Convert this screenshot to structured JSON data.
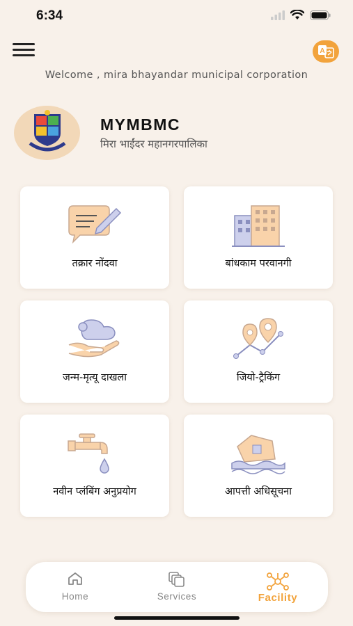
{
  "status": {
    "time": "6:34"
  },
  "header": {
    "welcome": "Welcome , mira bhayandar municipal corporation",
    "title": "MYMBMC",
    "subtitle": "मिरा भाईंदर महानगरपालिका"
  },
  "cards": [
    {
      "label": "तक्रार नोंदवा",
      "icon": "complaint-icon"
    },
    {
      "label": "बांधकाम परवानगी",
      "icon": "building-icon"
    },
    {
      "label": "जन्म-मृत्यू दाखला",
      "icon": "birth-death-icon"
    },
    {
      "label": "जियो-ट्रैकिंग",
      "icon": "geo-tracking-icon"
    },
    {
      "label": "नवीन प्लंबिंग अनुप्रयोग",
      "icon": "plumbing-tap-icon"
    },
    {
      "label": "आपत्ती अधिसूचना",
      "icon": "disaster-icon"
    }
  ],
  "nav": {
    "items": [
      {
        "label": "Home",
        "icon": "home-icon"
      },
      {
        "label": "Services",
        "icon": "services-icon"
      },
      {
        "label": "Facility",
        "icon": "facility-icon",
        "active": true
      }
    ]
  },
  "colors": {
    "accent": "#f2a33c",
    "background": "#f8f1ea",
    "icon_fill": "#cdd0ec",
    "icon_stroke": "#f2b77a"
  }
}
